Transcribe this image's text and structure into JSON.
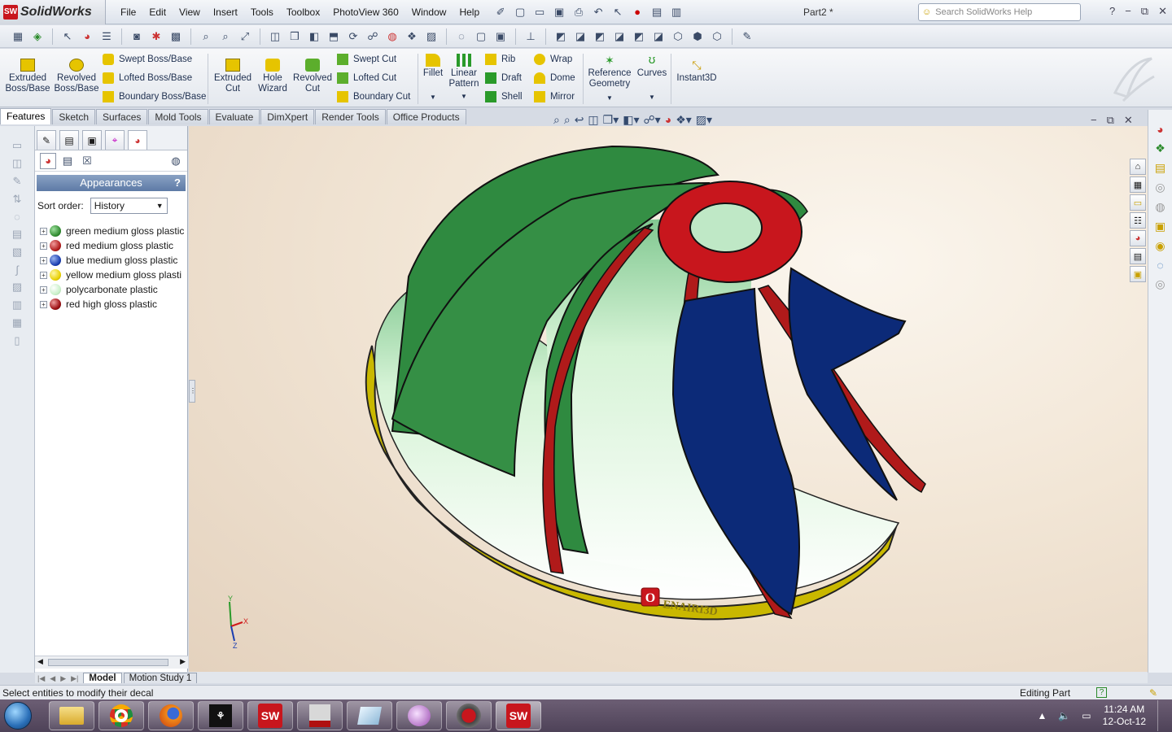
{
  "app": {
    "name": "SolidWorks",
    "logo_mark": "SW",
    "document_title": "Part2 *"
  },
  "menu": [
    "File",
    "Edit",
    "View",
    "Insert",
    "Tools",
    "Toolbox",
    "PhotoView 360",
    "Window",
    "Help"
  ],
  "help_search": {
    "placeholder": "Search SolidWorks Help"
  },
  "window_controls": {
    "help": "?",
    "minimize": "−",
    "restore": "⧉",
    "close": "✕"
  },
  "ribbon": {
    "extruded_boss": "Extruded Boss/Base",
    "revolved_boss": "Revolved Boss/Base",
    "swept_boss": "Swept Boss/Base",
    "lofted_boss": "Lofted Boss/Base",
    "boundary_boss": "Boundary Boss/Base",
    "extruded_cut": "Extruded Cut",
    "hole_wizard": "Hole Wizard",
    "revolved_cut": "Revolved Cut",
    "swept_cut": "Swept Cut",
    "lofted_cut": "Lofted Cut",
    "boundary_cut": "Boundary Cut",
    "fillet": "Fillet",
    "linear_pattern": "Linear Pattern",
    "rib": "Rib",
    "draft": "Draft",
    "shell": "Shell",
    "wrap": "Wrap",
    "dome": "Dome",
    "mirror": "Mirror",
    "reference_geometry": "Reference Geometry",
    "curves": "Curves",
    "instant3d": "Instant3D"
  },
  "command_tabs": [
    "Features",
    "Sketch",
    "Surfaces",
    "Mold Tools",
    "Evaluate",
    "DimXpert",
    "Render Tools",
    "Office Products"
  ],
  "panel": {
    "title": "Appearances",
    "help": "?",
    "sort_label": "Sort order:",
    "sort_value": "History",
    "appearances": [
      {
        "name": "green medium gloss plastic",
        "color": "#2f8a2f"
      },
      {
        "name": "red medium gloss plastic",
        "color": "#b01a1a"
      },
      {
        "name": "blue medium gloss plastic",
        "color": "#1a3db0"
      },
      {
        "name": "yellow medium gloss plasti",
        "color": "#e8d000"
      },
      {
        "name": "polycarbonate plastic",
        "color": "#c8f0c8"
      },
      {
        "name": "red high gloss plastic",
        "color": "#a01418"
      }
    ]
  },
  "model": {
    "decal_text": "ENAIRI3D",
    "decal_letter": "O",
    "triad_axes": [
      "Y",
      "X",
      "Z"
    ]
  },
  "bottom_tabs": [
    "Model",
    "Motion Study 1"
  ],
  "status": {
    "message": "Select entities to modify their decal",
    "mode": "Editing Part"
  },
  "taskbar": {
    "time": "11:24 AM",
    "date": "12-Oct-12",
    "sw_label": "SW"
  }
}
